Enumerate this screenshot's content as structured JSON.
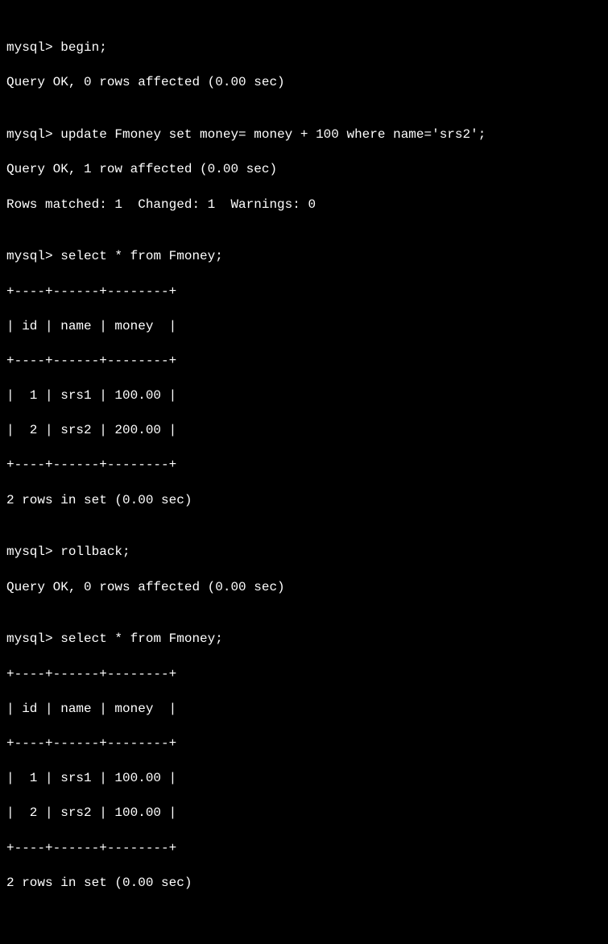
{
  "prompt": "mysql> ",
  "cmd1": "begin;",
  "resp1": "Query OK, 0 rows affected (0.00 sec)",
  "blank": "",
  "cmd2": "update Fmoney set money= money + 100 where name='srs2';",
  "resp2a": "Query OK, 1 row affected (0.00 sec)",
  "resp2b": "Rows matched: 1  Changed: 1  Warnings: 0",
  "cmd3": "select * from Fmoney;",
  "table1": {
    "border": "+----+------+--------+",
    "header": "| id | name | money  |",
    "row1": "|  1 | srs1 | 100.00 |",
    "row2": "|  2 | srs2 | 200.00 |",
    "footer": "2 rows in set (0.00 sec)"
  },
  "cmd4": "rollback;",
  "resp4": "Query OK, 0 rows affected (0.00 sec)",
  "cmd5": "select * from Fmoney;",
  "table2": {
    "border": "+----+------+--------+",
    "header": "| id | name | money  |",
    "row1": "|  1 | srs1 | 100.00 |",
    "row2": "|  2 | srs2 | 100.00 |",
    "footer": "2 rows in set (0.00 sec)"
  }
}
